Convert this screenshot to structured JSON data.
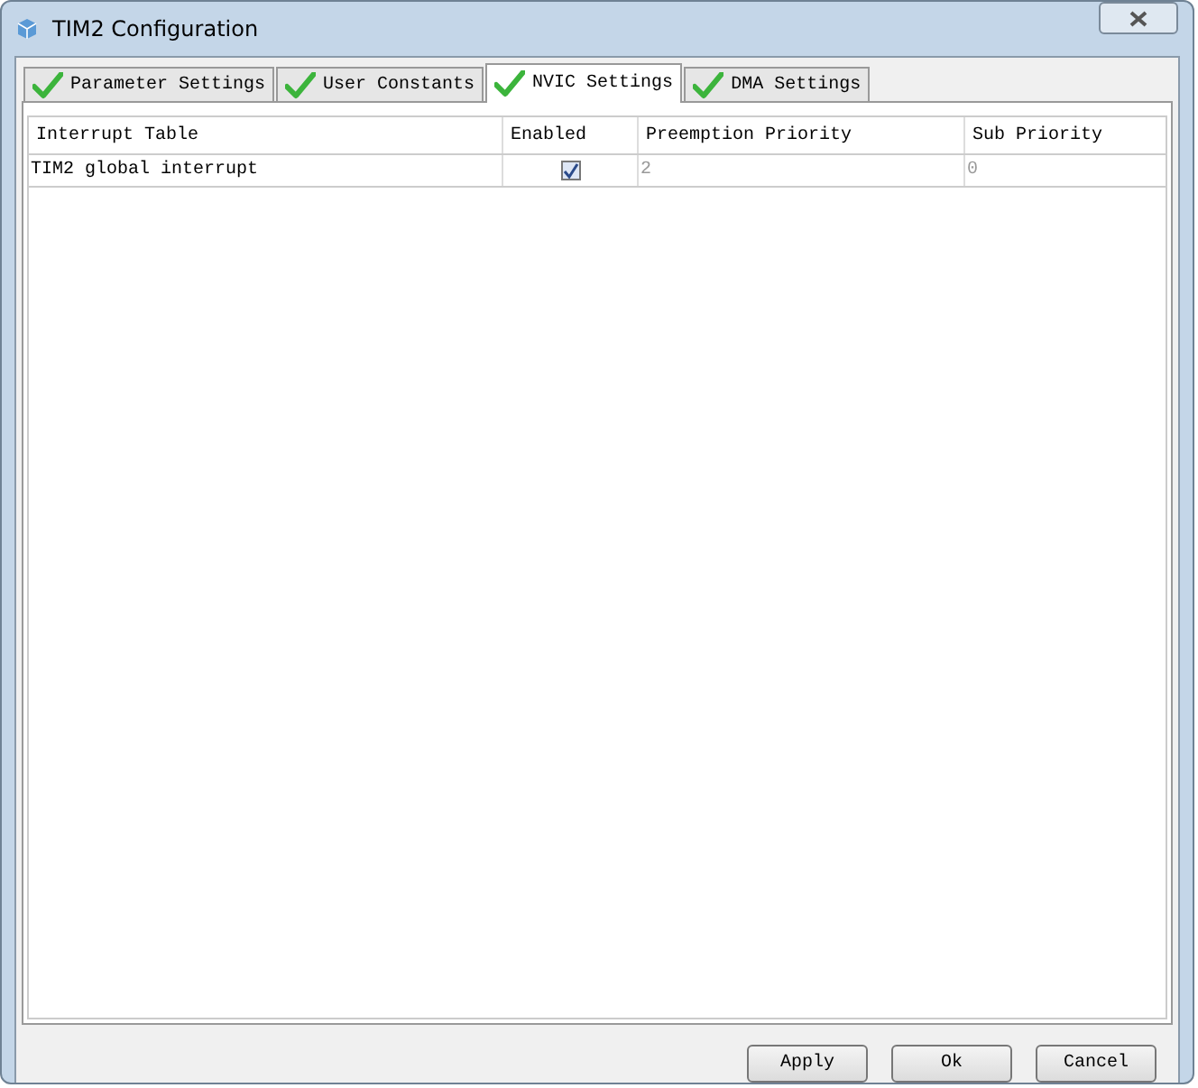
{
  "window": {
    "title": "TIM2 Configuration"
  },
  "tabs": [
    {
      "label": "Parameter Settings",
      "selected": false
    },
    {
      "label": "User Constants",
      "selected": false
    },
    {
      "label": "NVIC Settings",
      "selected": true
    },
    {
      "label": "DMA Settings",
      "selected": false
    }
  ],
  "table": {
    "columns": [
      "Interrupt Table",
      "Enabled",
      "Preemption Priority",
      "Sub Priority"
    ],
    "rows": [
      {
        "name": "TIM2 global interrupt",
        "enabled": true,
        "preemption_priority": "2",
        "sub_priority": "0"
      }
    ]
  },
  "buttons": [
    "Apply",
    "Ok",
    "Cancel"
  ]
}
